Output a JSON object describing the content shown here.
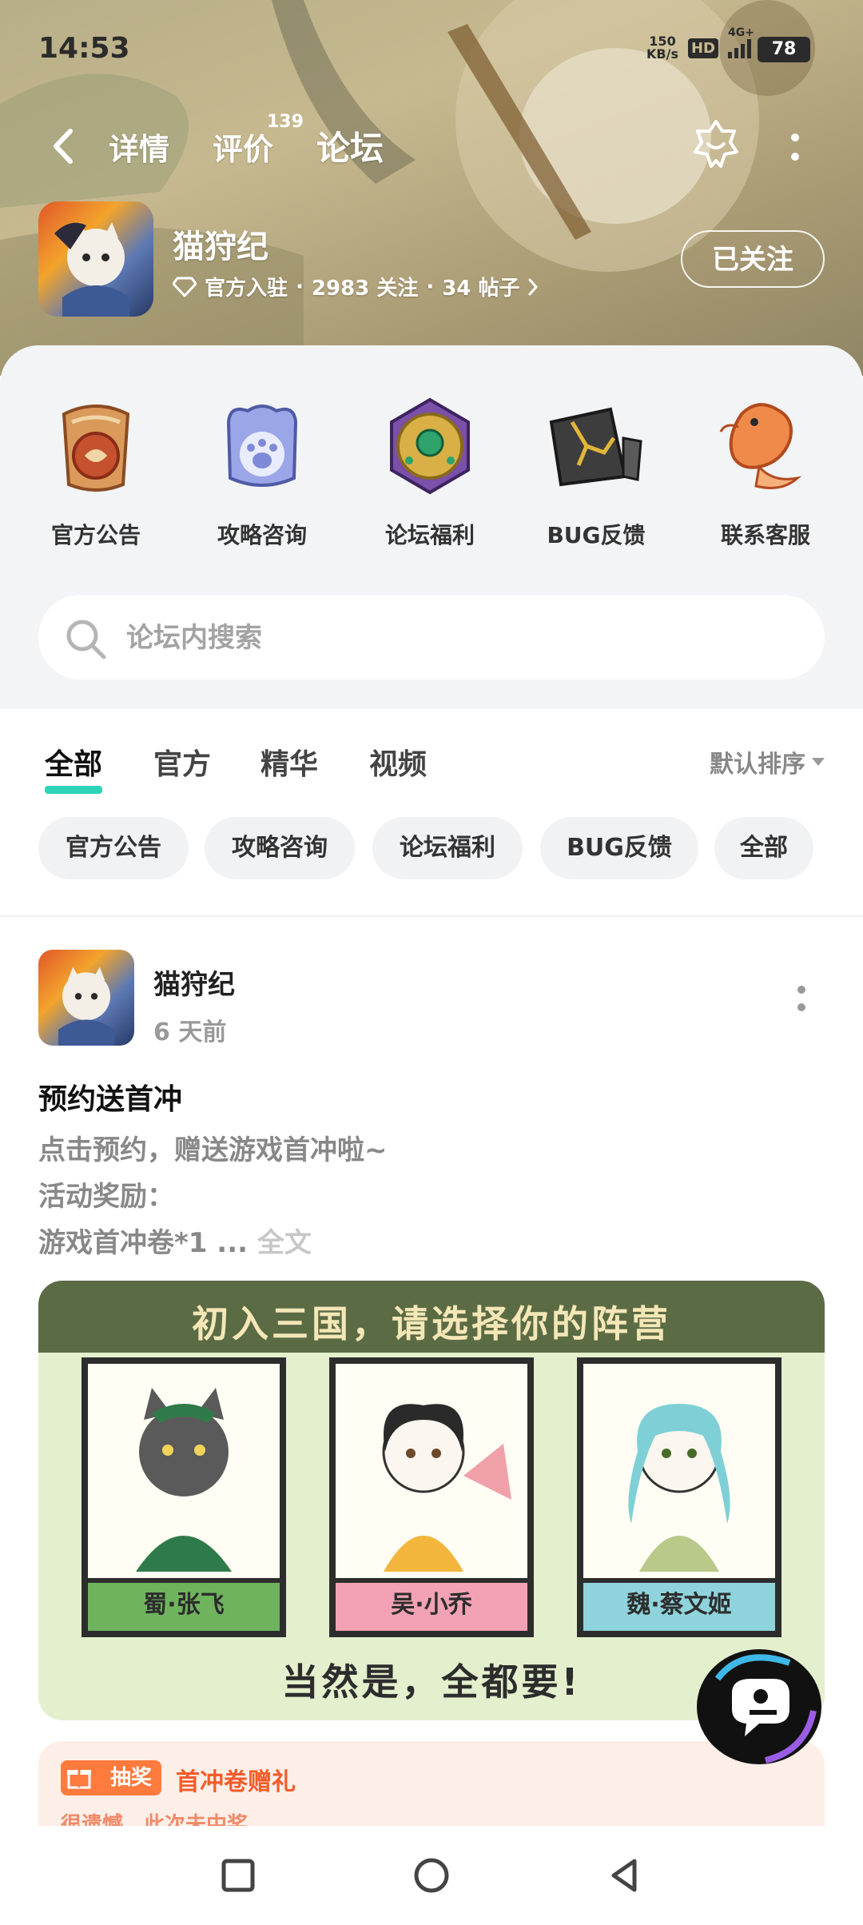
{
  "status_bar": {
    "time": "14:53",
    "net_speed": "150",
    "net_unit": "KB/s",
    "hd": "HD",
    "network": "4G+",
    "battery": "78"
  },
  "nav": {
    "tabs": [
      {
        "label": "详情",
        "badge": ""
      },
      {
        "label": "评价",
        "badge": "139"
      },
      {
        "label": "论坛",
        "badge": ""
      }
    ],
    "active_tab": "论坛"
  },
  "app": {
    "name": "猫狩纪",
    "official": "官方入驻",
    "followers": "2983 关注",
    "posts": "34 帖子",
    "follow_label": "已关注"
  },
  "quick_links": [
    {
      "label": "官方公告",
      "icon": "scroll-seal-icon"
    },
    {
      "label": "攻略咨询",
      "icon": "paw-badge-icon"
    },
    {
      "label": "论坛福利",
      "icon": "jade-medallion-icon"
    },
    {
      "label": "BUG反馈",
      "icon": "cracked-stone-icon"
    },
    {
      "label": "联系客服",
      "icon": "koi-fish-icon"
    }
  ],
  "search": {
    "placeholder": "论坛内搜索"
  },
  "filter_tabs": [
    "全部",
    "官方",
    "精华",
    "视频"
  ],
  "active_filter": "全部",
  "sort_label": "默认排序",
  "chips": [
    "官方公告",
    "攻略咨询",
    "论坛福利",
    "BUG反馈",
    "全部"
  ],
  "post": {
    "author": "猫狩纪",
    "time": "6 天前",
    "title": "预约送首冲",
    "lines": [
      "点击预约，赠送游戏首冲啦~",
      "活动奖励：",
      "游戏首冲卷*1"
    ],
    "ellipsis": " ... ",
    "full_text": "全文",
    "image": {
      "title": "初入三国，请选择你的阵营",
      "cards": [
        "蜀·张飞",
        "吴·小乔",
        "魏·蔡文姬"
      ],
      "footer": "当然是，全都要!"
    },
    "lottery": {
      "badge": "抽奖",
      "title": "首冲卷赠礼",
      "sub": "很遗憾，此次未中奖"
    }
  },
  "colors": {
    "accent": "#2fd3b7",
    "lottery": "#ff7a3d",
    "card_green": "#6fb35e",
    "card_pink": "#f2a2b4",
    "card_cyan": "#8fd3dc"
  }
}
